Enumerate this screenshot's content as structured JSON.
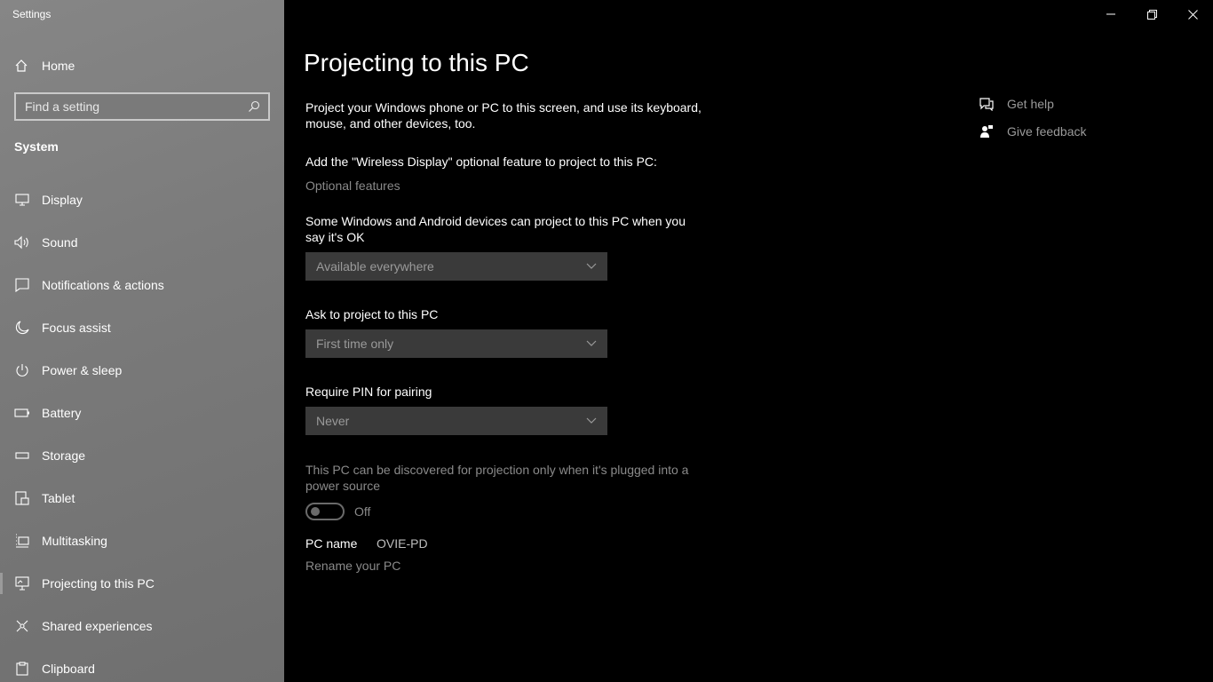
{
  "window": {
    "title": "Settings"
  },
  "sidebar": {
    "home_label": "Home",
    "search_placeholder": "Find a setting",
    "section": "System",
    "items": [
      {
        "label": "Display",
        "icon": "display-icon"
      },
      {
        "label": "Sound",
        "icon": "sound-icon"
      },
      {
        "label": "Notifications & actions",
        "icon": "notifications-icon"
      },
      {
        "label": "Focus assist",
        "icon": "moon-icon"
      },
      {
        "label": "Power & sleep",
        "icon": "power-icon"
      },
      {
        "label": "Battery",
        "icon": "battery-icon"
      },
      {
        "label": "Storage",
        "icon": "storage-icon"
      },
      {
        "label": "Tablet",
        "icon": "tablet-icon"
      },
      {
        "label": "Multitasking",
        "icon": "multitasking-icon"
      },
      {
        "label": "Projecting to this PC",
        "icon": "projecting-icon",
        "active": true
      },
      {
        "label": "Shared experiences",
        "icon": "shared-experiences-icon"
      },
      {
        "label": "Clipboard",
        "icon": "clipboard-icon"
      }
    ]
  },
  "main": {
    "title": "Projecting to this PC",
    "intro": "Project your Windows phone or PC to this screen, and use its keyboard, mouse, and other devices, too.",
    "wireless_prompt": "Add the \"Wireless Display\" optional feature to project to this PC:",
    "optional_features_link": "Optional features",
    "availability_label": "Some Windows and Android devices can project to this PC when you say it's OK",
    "availability_value": "Available everywhere",
    "ask_label": "Ask to project to this PC",
    "ask_value": "First time only",
    "pin_label": "Require PIN for pairing",
    "pin_value": "Never",
    "power_note": "This PC can be discovered for projection only when it's plugged into a power source",
    "toggle_state": "Off",
    "pc_name_label": "PC name",
    "pc_name_value": "OVIE-PD",
    "rename_link": "Rename your PC"
  },
  "help": {
    "get_help": "Get help",
    "give_feedback": "Give feedback"
  }
}
